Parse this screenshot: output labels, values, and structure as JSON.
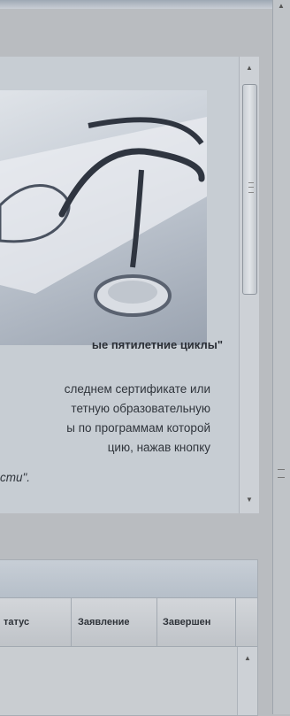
{
  "section": {
    "heading": "ые пятилетние циклы\"",
    "paragraph_lines": [
      "следнем сертификате или",
      "тетную образовательную",
      "ы по программам которой",
      "цию,        нажав        кнопку"
    ],
    "italic_tail": "сти\"."
  },
  "table": {
    "columns": [
      "татус",
      "Заявление",
      "Завершен"
    ]
  },
  "icons": {
    "scroll_up": "up-arrow-icon",
    "scroll_down": "down-arrow-icon",
    "image": "stethoscope-glasses-photo"
  }
}
